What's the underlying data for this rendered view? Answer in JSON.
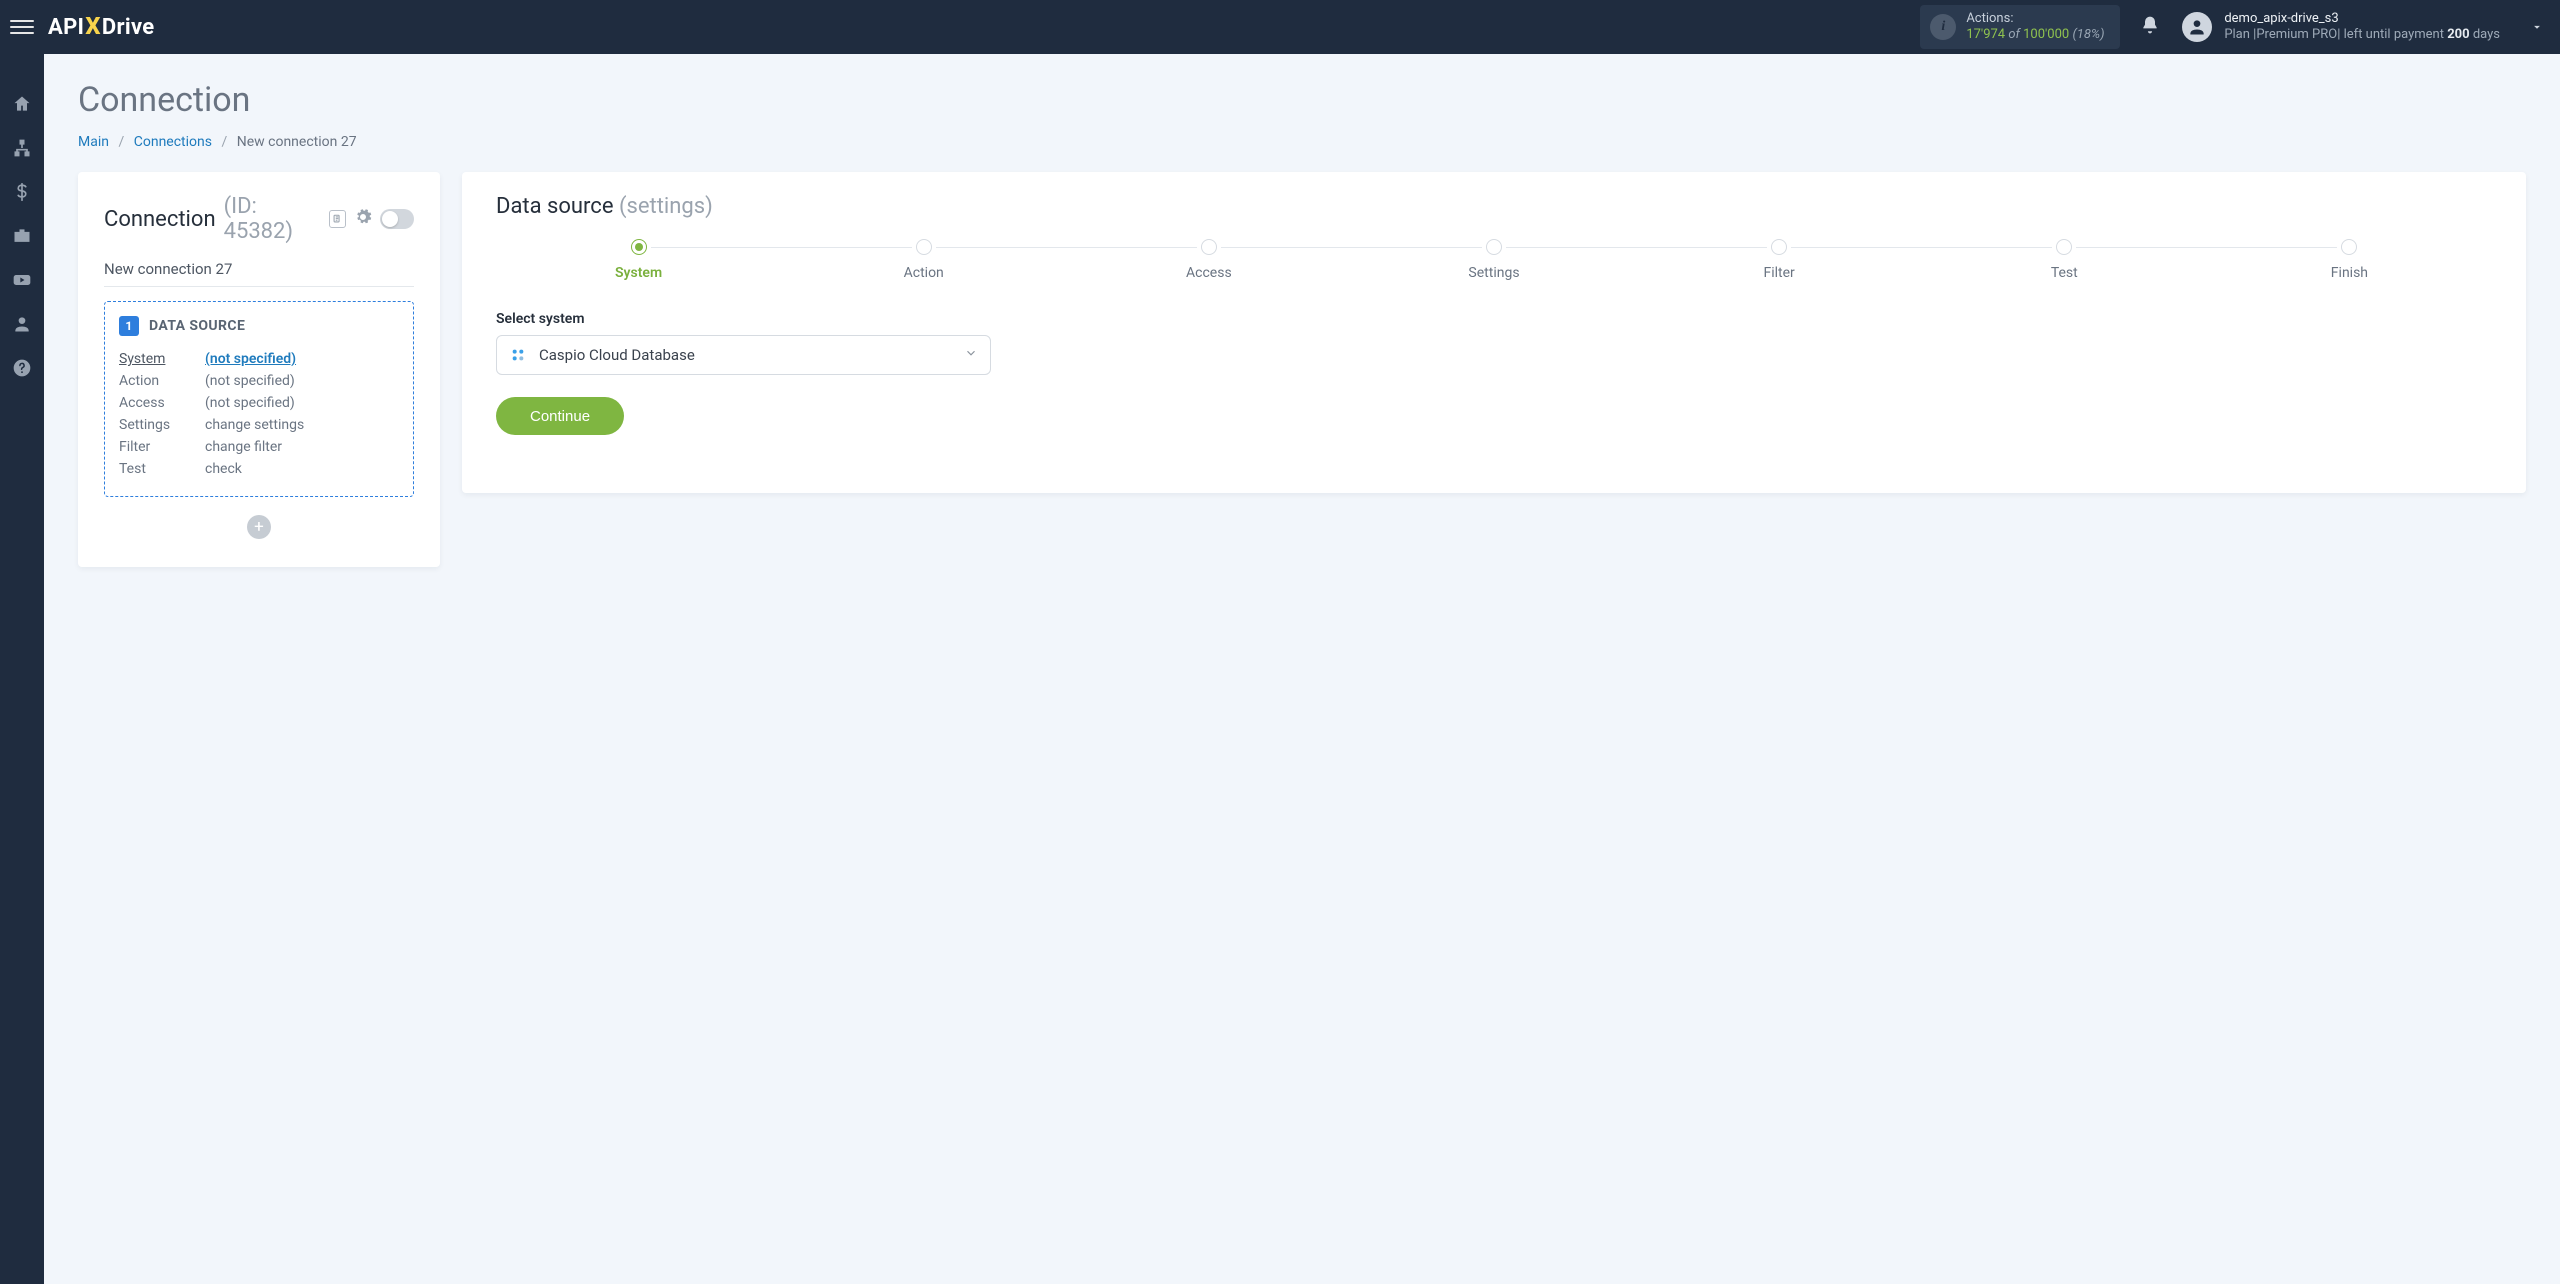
{
  "brand": {
    "part1": "API",
    "x": "X",
    "part2": "Drive"
  },
  "header": {
    "actions": {
      "label": "Actions:",
      "count": "17'974",
      "of": " of ",
      "max": "100'000",
      "pct": "(18%)"
    },
    "user": {
      "name": "demo_apix-drive_s3",
      "plan_prefix": "Plan |",
      "plan_name": "Premium PRO",
      "plan_suffix": "| left until payment ",
      "days": "200",
      "days_unit": " days"
    }
  },
  "page": {
    "title": "Connection",
    "breadcrumb": {
      "main": "Main",
      "connections": "Connections",
      "current": "New connection 27"
    }
  },
  "left": {
    "title": "Connection",
    "id_label": "(ID: 45382)",
    "subtitle": "New connection 27",
    "ds_badge": "1",
    "ds_title": "DATA SOURCE",
    "rows": [
      {
        "k": "System",
        "v": "(not specified)",
        "active": true
      },
      {
        "k": "Action",
        "v": "(not specified)",
        "active": false
      },
      {
        "k": "Access",
        "v": "(not specified)",
        "active": false
      },
      {
        "k": "Settings",
        "v": "change settings",
        "active": false
      },
      {
        "k": "Filter",
        "v": "change filter",
        "active": false
      },
      {
        "k": "Test",
        "v": "check",
        "active": false
      }
    ]
  },
  "right": {
    "title": "Data source",
    "title_suffix": "(settings)",
    "steps": [
      "System",
      "Action",
      "Access",
      "Settings",
      "Filter",
      "Test",
      "Finish"
    ],
    "active_step": 0,
    "form_label": "Select system",
    "dropdown_value": "Caspio Cloud Database",
    "continue": "Continue"
  }
}
